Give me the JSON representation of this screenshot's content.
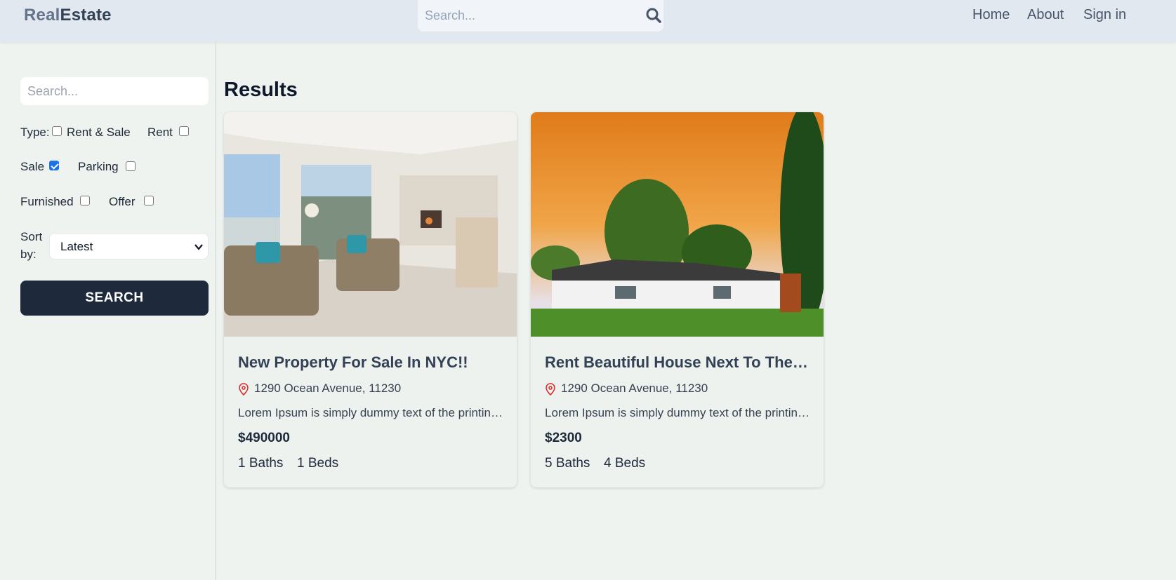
{
  "header": {
    "logo_part1": "Real",
    "logo_part2": "Estate",
    "search_placeholder": "Search...",
    "nav": [
      "Home",
      "About",
      "Sign in"
    ]
  },
  "sidebar": {
    "search_placeholder": "Search...",
    "type_label": "Type:",
    "filters": {
      "rent_and_sale": {
        "label": "Rent & Sale",
        "checked": false
      },
      "rent": {
        "label": "Rent",
        "checked": false
      },
      "sale": {
        "label": "Sale",
        "checked": true
      },
      "parking": {
        "label": "Parking",
        "checked": false
      },
      "furnished": {
        "label": "Furnished",
        "checked": false
      },
      "offer": {
        "label": "Offer",
        "checked": false
      }
    },
    "sort_label_1": "Sort",
    "sort_label_2": "by:",
    "sort_value": "Latest",
    "search_button": "SEARCH"
  },
  "results": {
    "title": "Results",
    "listings": [
      {
        "title": "New Property For Sale In NYC!!",
        "address": "1290 Ocean Avenue, 11230",
        "description": "Lorem Ipsum is simply dummy text of the printing and typesetting industry.",
        "price": "$490000",
        "baths": "1 Baths",
        "beds": "1 Beds"
      },
      {
        "title": "Rent Beautiful House Next To The Ocean",
        "address": "1290 Ocean Avenue, 11230",
        "description": "Lorem Ipsum is simply dummy text of the printing and typesetting industry.",
        "price": "$2300",
        "baths": "5 Baths",
        "beds": "4 Beds"
      }
    ]
  },
  "colors": {
    "header_bg": "#e2e8f0",
    "page_bg": "#eff3ef",
    "button_bg": "#1e293b",
    "checkbox_checked": "#1a73e8",
    "pin_icon": "#dc2626"
  }
}
